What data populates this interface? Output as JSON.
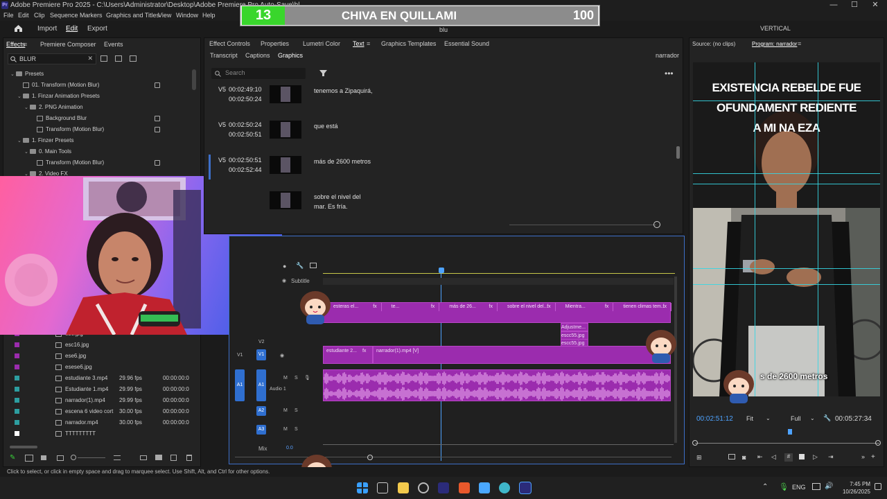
{
  "title_bar": {
    "title": "Adobe Premiere Pro 2025 - C:\\Users\\Administrator\\Desktop\\Adobe Premiere Pro Auto-Save\\bl",
    "minimize": "—",
    "maximize": "☐",
    "close": "✕"
  },
  "menu": [
    "File",
    "Edit",
    "Clip",
    "Sequence",
    "Markers",
    "Graphics and Titles",
    "View",
    "Window",
    "Help"
  ],
  "header": {
    "home_icon": "home-icon",
    "tabs": [
      "Import",
      "Edit",
      "Export"
    ],
    "active_tab": "Edit",
    "project_name": "blu",
    "layout_label": "VERTICAL"
  },
  "score_overlay": {
    "left_number": "13",
    "label": "CHIVA EN QUILLAMI",
    "right_number": "100",
    "progress_fraction": 0.13
  },
  "effects_panel": {
    "tabs": [
      "Effects",
      "Premiere Composer",
      "Events"
    ],
    "search_value": "BLUR",
    "tree": [
      {
        "label": "Presets",
        "indent": 0,
        "type": "folder",
        "expanded": true
      },
      {
        "label": "01. Transform (Motion Blur)",
        "indent": 1,
        "type": "fx",
        "badge": true
      },
      {
        "label": "1. Finzar Animation Presets",
        "indent": 1,
        "type": "folder",
        "expanded": true
      },
      {
        "label": "2. PNG Animation",
        "indent": 2,
        "type": "folder",
        "expanded": true
      },
      {
        "label": "Background Blur",
        "indent": 3,
        "type": "fx",
        "badge": true
      },
      {
        "label": "Transform (Motion Blur)",
        "indent": 3,
        "type": "fx",
        "badge": true
      },
      {
        "label": "1. Finzer Presets",
        "indent": 1,
        "type": "folder",
        "expanded": true
      },
      {
        "label": "0. Main Tools",
        "indent": 2,
        "type": "folder",
        "expanded": true
      },
      {
        "label": "Transform (Motion Blur)",
        "indent": 3,
        "type": "fx",
        "badge": true
      },
      {
        "label": "2. Video FX",
        "indent": 2,
        "type": "folder",
        "expanded": true
      }
    ]
  },
  "project_items": [
    {
      "name": "es6.jpg",
      "fps": "",
      "start": "",
      "color": "#9b2cae"
    },
    {
      "name": "esc16.jpg",
      "fps": "",
      "start": "",
      "color": "#9b2cae"
    },
    {
      "name": "ese6.jpg",
      "fps": "",
      "start": "",
      "color": "#9b2cae"
    },
    {
      "name": "esese6.jpg",
      "fps": "",
      "start": "",
      "color": "#9b2cae"
    },
    {
      "name": "estudiante 3.mp4",
      "fps": "29.96 fps",
      "start": "00:00:00:0",
      "color": "#2d9ea0"
    },
    {
      "name": "Estudiante 1.mp4",
      "fps": "29.99 fps",
      "start": "00:00:00:0",
      "color": "#2d9ea0"
    },
    {
      "name": "narrador(1).mp4",
      "fps": "29.99 fps",
      "start": "00:00:00:0",
      "color": "#2d9ea0"
    },
    {
      "name": "escena 6 video cort",
      "fps": "30.00 fps",
      "start": "00:00:00:0",
      "color": "#2d9ea0"
    },
    {
      "name": "narrador.mp4",
      "fps": "30.00 fps",
      "start": "00:00:00:0",
      "color": "#2d9ea0"
    },
    {
      "name": "TTTTTTTTT",
      "fps": "",
      "start": "",
      "color": "#ffffff"
    }
  ],
  "text_panel": {
    "top_tabs": [
      "Effect Controls",
      "Properties",
      "Lumetri Color",
      "Text",
      "Graphics Templates",
      "Essential Sound"
    ],
    "active_top_tab": "Text",
    "sub_tabs": [
      "Transcript",
      "Captions",
      "Graphics"
    ],
    "active_sub_tab": "Graphics",
    "track_name": "narrador",
    "search_placeholder": "Search",
    "captions": [
      {
        "track": "V5",
        "in": "00:02:49:10",
        "out": "00:02:50:24",
        "text": "tenemos a Zipaquirá,",
        "selected": false
      },
      {
        "track": "V5",
        "in": "00:02:50:24",
        "out": "00:02:50:51",
        "text": "que está",
        "selected": false
      },
      {
        "track": "V5",
        "in": "00:02:50:51",
        "out": "00:02:52:44",
        "text": "más de 2600 metros",
        "selected": true
      },
      {
        "track": "",
        "in": "",
        "out": "",
        "text": "sobre el nivel del\nmar. Es fría.",
        "selected": false
      }
    ]
  },
  "timeline": {
    "subtitle_label": "Subtitle",
    "subtitle_clips": [
      {
        "label": "esteras el...",
        "fx": "fx"
      },
      {
        "label": "te...",
        "fx": "fx"
      },
      {
        "label": "más de 26...",
        "fx": "fx"
      },
      {
        "label": "sobre el nivel del...",
        "fx": "fx"
      },
      {
        "label": "Mientra...",
        "fx": "fx"
      },
      {
        "label": "tienen climas tem...",
        "fx": "fx"
      }
    ],
    "small_clips": [
      "Adjustme...",
      "escc55.jpg",
      "escc55.jpg"
    ],
    "video_tracks": [
      {
        "name": "V2",
        "label": "V2"
      },
      {
        "name": "V1",
        "label": "V1"
      }
    ],
    "v1_clips": [
      {
        "label": "estudiante 2...",
        "fx": "fx"
      },
      {
        "label": "narrador(1).mp4 [V]",
        "fx": ""
      }
    ],
    "audio_tracks": [
      {
        "name": "A1",
        "label": "Audio 1"
      },
      {
        "name": "A2",
        "label": ""
      },
      {
        "name": "A3",
        "label": ""
      }
    ],
    "mix_label": "Mix",
    "mix_value": "0.0",
    "track_buttons": [
      "M",
      "S"
    ]
  },
  "program_monitor": {
    "source_label": "Source: (no clips)",
    "program_label": "Program: narrador",
    "timecode": "00:02:51:12",
    "duration": "00:05:27:34",
    "fit": "Fit",
    "quality": "Full",
    "caption_text": "s de 2600 metros",
    "poster_lines": [
      "EXISTENCIA REBELDE FUE",
      "OFUNDAMENT  REDIENTE",
      "A MI NA      EZA"
    ]
  },
  "status_bar": {
    "text": "Click to select, or click in empty space and drag to marquee select. Use Shift, Alt, and Ctrl for other options."
  },
  "taskbar": {
    "language": "ENG",
    "time": "7:45 PM",
    "date": "10/26/2025"
  },
  "colors": {
    "clip_purple": "#9b2cae",
    "accent_blue": "#3d6fc9",
    "playhead": "#4ea3ff",
    "score_green": "#39d62c",
    "guide_cyan": "#35d6e3"
  }
}
